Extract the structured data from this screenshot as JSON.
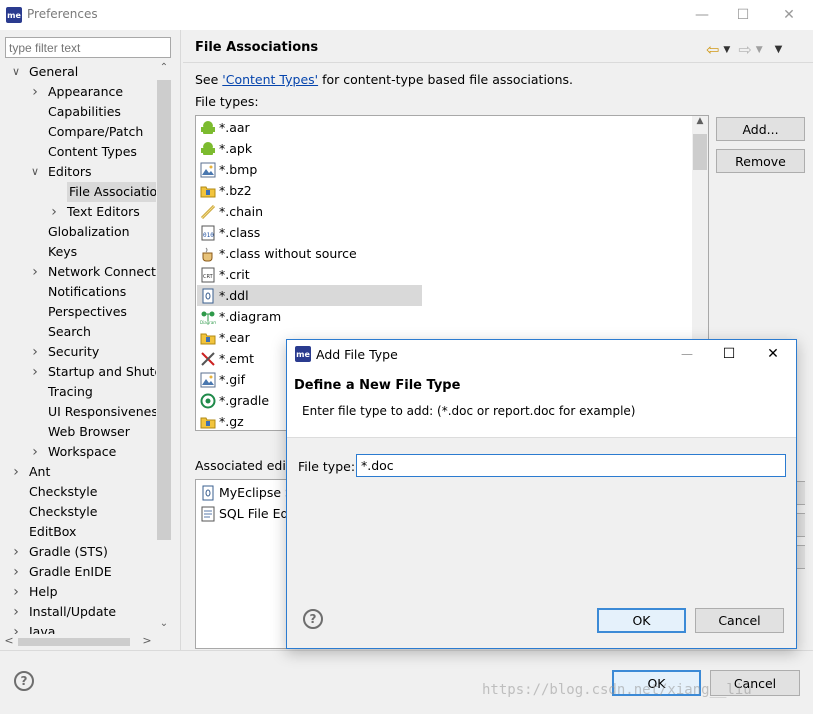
{
  "window": {
    "title": "Preferences",
    "icon_text": "me"
  },
  "filter": {
    "placeholder": "type filter text"
  },
  "tree": [
    {
      "label": "General",
      "level": 0,
      "state": "expanded"
    },
    {
      "label": "Appearance",
      "level": 1,
      "state": "collapsed"
    },
    {
      "label": "Capabilities",
      "level": 1,
      "state": "leaf"
    },
    {
      "label": "Compare/Patch",
      "level": 1,
      "state": "leaf"
    },
    {
      "label": "Content Types",
      "level": 1,
      "state": "leaf"
    },
    {
      "label": "Editors",
      "level": 1,
      "state": "expanded"
    },
    {
      "label": "File Associations",
      "level": 2,
      "state": "leaf",
      "selected": true
    },
    {
      "label": "Text Editors",
      "level": 2,
      "state": "collapsed"
    },
    {
      "label": "Globalization",
      "level": 1,
      "state": "leaf"
    },
    {
      "label": "Keys",
      "level": 1,
      "state": "leaf"
    },
    {
      "label": "Network Connections",
      "level": 1,
      "state": "collapsed"
    },
    {
      "label": "Notifications",
      "level": 1,
      "state": "leaf"
    },
    {
      "label": "Perspectives",
      "level": 1,
      "state": "leaf"
    },
    {
      "label": "Search",
      "level": 1,
      "state": "leaf"
    },
    {
      "label": "Security",
      "level": 1,
      "state": "collapsed"
    },
    {
      "label": "Startup and Shutdown",
      "level": 1,
      "state": "collapsed"
    },
    {
      "label": "Tracing",
      "level": 1,
      "state": "leaf"
    },
    {
      "label": "UI Responsiveness",
      "level": 1,
      "state": "leaf"
    },
    {
      "label": "Web Browser",
      "level": 1,
      "state": "leaf"
    },
    {
      "label": "Workspace",
      "level": 1,
      "state": "collapsed"
    },
    {
      "label": "Ant",
      "level": 0,
      "state": "collapsed"
    },
    {
      "label": "Checkstyle",
      "level": 0,
      "state": "leaf"
    },
    {
      "label": "Checkstyle",
      "level": 0,
      "state": "leaf"
    },
    {
      "label": "EditBox",
      "level": 0,
      "state": "leaf"
    },
    {
      "label": "Gradle (STS)",
      "level": 0,
      "state": "collapsed"
    },
    {
      "label": "Gradle EnIDE",
      "level": 0,
      "state": "collapsed"
    },
    {
      "label": "Help",
      "level": 0,
      "state": "collapsed"
    },
    {
      "label": "Install/Update",
      "level": 0,
      "state": "collapsed"
    },
    {
      "label": "Java",
      "level": 0,
      "state": "collapsed"
    }
  ],
  "page": {
    "title": "File Associations",
    "see_prefix": "See ",
    "see_link": "'Content Types'",
    "see_suffix": " for content-type based file associations.",
    "file_types_label": "File types:",
    "associated_label": "Associated editors:",
    "add_button": "Add...",
    "remove_button": "Remove"
  },
  "file_types": [
    {
      "name": "*.aar",
      "icon": "android-icon"
    },
    {
      "name": "*.apk",
      "icon": "android-icon"
    },
    {
      "name": "*.bmp",
      "icon": "image-file-icon"
    },
    {
      "name": "*.bz2",
      "icon": "archive-folder-icon"
    },
    {
      "name": "*.chain",
      "icon": "chain-icon"
    },
    {
      "name": "*.class",
      "icon": "class-file-icon"
    },
    {
      "name": "*.class without source",
      "icon": "coffee-icon"
    },
    {
      "name": "*.crit",
      "icon": "certificate-icon"
    },
    {
      "name": "*.ddl",
      "icon": "ddl-file-icon",
      "selected": true
    },
    {
      "name": "*.diagram",
      "icon": "diagram-icon"
    },
    {
      "name": "*.ear",
      "icon": "archive-folder-icon"
    },
    {
      "name": "*.emt",
      "icon": "tools-icon"
    },
    {
      "name": "*.gif",
      "icon": "image-file-icon"
    },
    {
      "name": "*.gradle",
      "icon": "gradle-icon"
    },
    {
      "name": "*.gz",
      "icon": "archive-folder-icon"
    }
  ],
  "associated_editors": [
    {
      "name": "MyEclipse S",
      "icon": "ddl-file-icon"
    },
    {
      "name": "SQL File Edi",
      "icon": "sql-editor-icon"
    }
  ],
  "dialog": {
    "title": "Add File Type",
    "heading": "Define a New File Type",
    "description": "Enter file type to add: (*.doc or report.doc for example)",
    "field_label": "File type:",
    "field_value": "*.doc",
    "ok": "OK",
    "cancel": "Cancel"
  },
  "footer": {
    "ok": "OK",
    "cancel": "Cancel"
  },
  "watermark": "https://blog.csdn.net/xiang__liu"
}
